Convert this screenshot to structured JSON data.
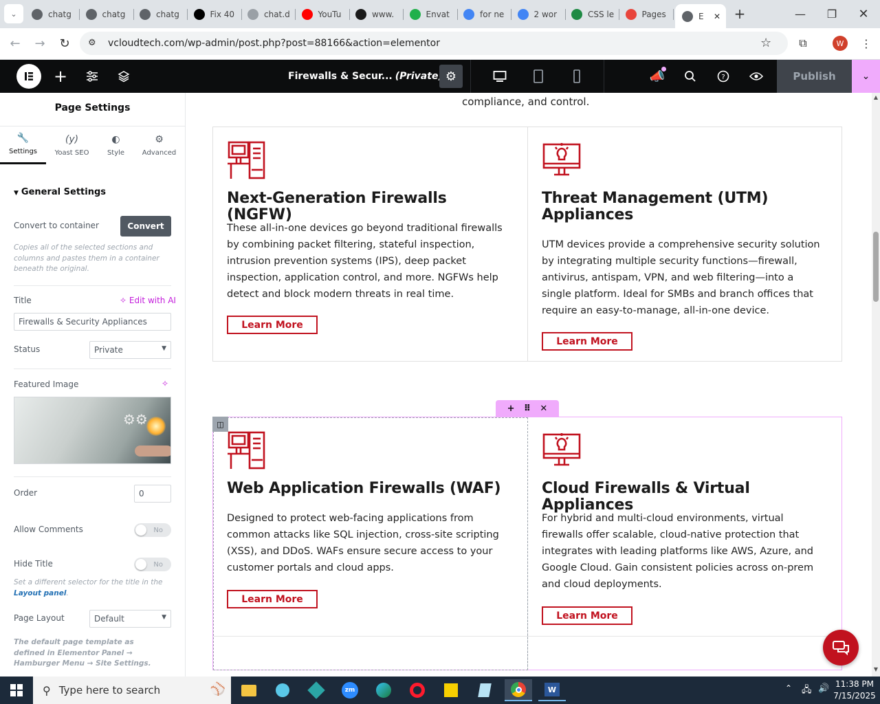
{
  "browser": {
    "tabs": [
      {
        "title": "chatg",
        "color": "#5f6368"
      },
      {
        "title": "chatg",
        "color": "#5f6368"
      },
      {
        "title": "chatg",
        "color": "#5f6368"
      },
      {
        "title": "Fix 40",
        "color": "#000000"
      },
      {
        "title": "chat.d",
        "color": "#9aa0a6"
      },
      {
        "title": "YouTu",
        "color": "#ff0000"
      },
      {
        "title": "www.",
        "color": "#1a1a1a"
      },
      {
        "title": "Envat",
        "color": "#21b04b"
      },
      {
        "title": "for ne",
        "color": "#4285f4"
      },
      {
        "title": "2 wor",
        "color": "#4285f4"
      },
      {
        "title": "CSS le",
        "color": "#1e8a44"
      },
      {
        "title": "Pages",
        "color": "#e8453c"
      },
      {
        "title": "E",
        "color": "#5f6368"
      }
    ],
    "url": "vcloudtech.com/wp-admin/post.php?post=88166&action=elementor",
    "profile_initial": "W"
  },
  "elementor": {
    "page_title": "Firewalls & Secur...",
    "page_status": "(Private)",
    "publish_label": "Publish"
  },
  "panel": {
    "heading": "Page Settings",
    "tabs": [
      {
        "label": "Settings",
        "icon": "wrench-icon"
      },
      {
        "label": "Yoast SEO",
        "icon": "yoast-icon"
      },
      {
        "label": "Style",
        "icon": "contrast-icon"
      },
      {
        "label": "Advanced",
        "icon": "gear-icon"
      }
    ],
    "section_title": "General Settings",
    "convert_label": "Convert to container",
    "convert_button": "Convert",
    "convert_note": "Copies all of the selected sections and columns and pastes them in a container beneath the original.",
    "title_label": "Title",
    "edit_ai": "Edit with AI",
    "title_value": "Firewalls & Security Appliances",
    "status_label": "Status",
    "status_value": "Private",
    "featured_label": "Featured Image",
    "order_label": "Order",
    "order_value": "0",
    "comments_label": "Allow Comments",
    "comments_toggle": "No",
    "hide_title_label": "Hide Title",
    "hide_title_toggle": "No",
    "hide_title_note_a": "Set a different selector for the title in the",
    "hide_title_note_link": "Layout panel",
    "layout_label": "Page Layout",
    "layout_value": "Default",
    "layout_note": "The default page template as defined in Elementor Panel → Hamburger Menu → Site Settings."
  },
  "canvas": {
    "top_text": "compliance, and control.",
    "learn_more": "Learn More",
    "cards": [
      {
        "title": "Next-Generation Firewalls (NGFW)",
        "text": "These all-in-one devices go beyond traditional firewalls by combining packet filtering, stateful inspection, intrusion prevention systems (IPS), deep packet inspection, application control, and more. NGFWs help detect and block modern threats in real time.",
        "icon": "workstation-icon"
      },
      {
        "title": "Threat Management (UTM) Appliances",
        "text": "UTM devices provide a comprehensive security solution by integrating multiple security functions—firewall, antivirus, antispam, VPN, and web filtering—into a single platform. Ideal for SMBs and branch offices that require an easy-to-manage, all-in-one device.",
        "icon": "monitor-bulb-icon"
      },
      {
        "title": "Web Application Firewalls (WAF)",
        "text": "Designed to protect web-facing applications from common attacks like SQL injection, cross-site scripting (XSS), and DDoS. WAFs ensure secure access to your customer portals and cloud apps.",
        "icon": "workstation-icon"
      },
      {
        "title": "Cloud Firewalls & Virtual Appliances",
        "text": "For hybrid and multi-cloud environments, virtual firewalls offer scalable, cloud-native protection that integrates with leading platforms like AWS, Azure, and Google Cloud. Gain consistent policies across on-prem and cloud deployments.",
        "icon": "monitor-bulb-icon"
      }
    ],
    "accent": "#c1121f"
  },
  "taskbar": {
    "search_placeholder": "Type here to search",
    "time": "11:38 PM",
    "date": "7/15/2025"
  }
}
